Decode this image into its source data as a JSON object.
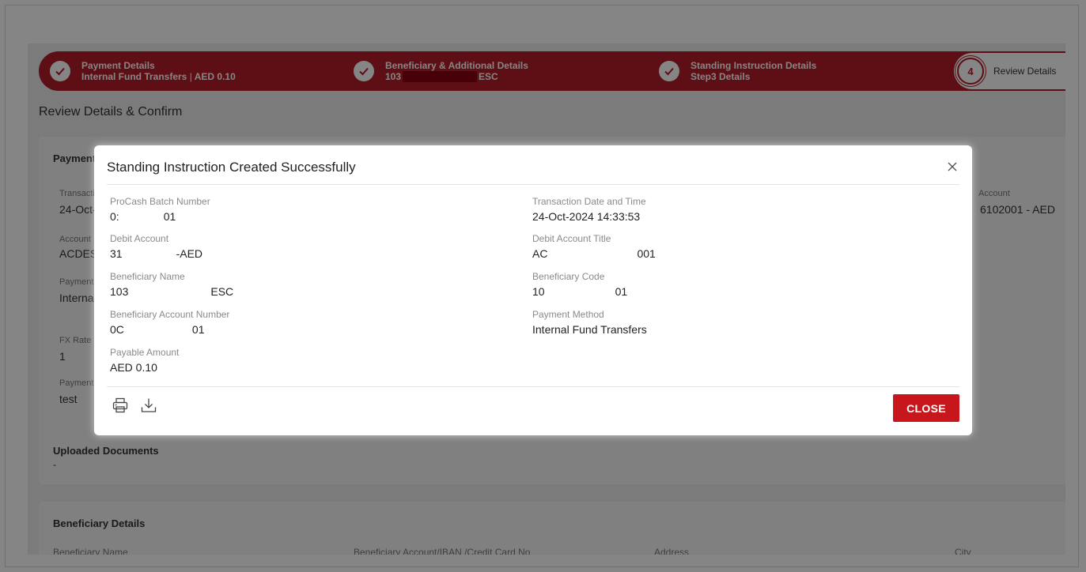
{
  "stepper": {
    "step1": {
      "title": "Payment Details",
      "subtitle": "Internal Fund Transfers",
      "amount": "AED 0.10"
    },
    "step2": {
      "title": "Beneficiary & Additional Details",
      "prefix": "103",
      "suffix": "ESC"
    },
    "step3": {
      "title": "Standing Instruction Details",
      "subtitle": "Step3 Details"
    },
    "step4": {
      "number": "4",
      "label": "Review Details"
    }
  },
  "page": {
    "title": "Review Details & Confirm"
  },
  "background": {
    "payment_section": "Payment",
    "transaction_label": "Transacti",
    "transaction_value": "24-Oct-",
    "account_label": "Account",
    "account_value": "ACDESC",
    "payment_label": "Payment",
    "payment_value": "Internal",
    "fx_label": "FX Rate",
    "fx_value": "1",
    "payment2_label": "Payment",
    "payment2_value": "test",
    "right_account_label": "Account",
    "right_account_value": "6102001 - AED",
    "uploaded_title": "Uploaded Documents",
    "uploaded_value": "-",
    "beneficiary_title": "Beneficiary Details",
    "col_name": "Beneficiary Name",
    "col_account": "Beneficiary Account/IBAN /Credit Card No",
    "col_address": "Address",
    "col_city": "City"
  },
  "modal": {
    "title": "Standing Instruction Created Successfully",
    "fields": {
      "procash": {
        "label": "ProCash Batch Number",
        "prefix": "0:",
        "suffix": "01"
      },
      "txn_datetime": {
        "label": "Transaction Date and Time",
        "value": "24-Oct-2024 14:33:53"
      },
      "debit_account": {
        "label": "Debit Account",
        "prefix": "31",
        "suffix": "-AED"
      },
      "debit_title": {
        "label": "Debit Account Title",
        "prefix": "AC",
        "suffix": "001"
      },
      "ben_name": {
        "label": "Beneficiary Name",
        "prefix": "103",
        "suffix": "ESC"
      },
      "ben_code": {
        "label": "Beneficiary Code",
        "prefix": "10",
        "suffix": "01"
      },
      "ben_account": {
        "label": "Beneficiary Account Number",
        "prefix": "0C",
        "suffix": "01"
      },
      "payment_method": {
        "label": "Payment Method",
        "value": "Internal Fund Transfers"
      },
      "payable_amount": {
        "label": "Payable Amount",
        "value": "AED 0.10"
      }
    },
    "close_label": "CLOSE",
    "icons": [
      "printer-icon",
      "download-icon",
      "close-icon",
      "check-icon"
    ]
  }
}
